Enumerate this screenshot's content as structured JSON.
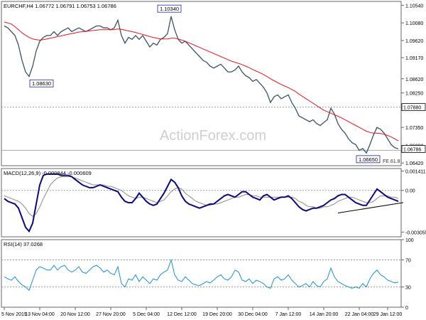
{
  "chart_data": [
    {
      "type": "line",
      "panel": "price",
      "title": "EURCHF,H4  1.06772 1.06791 1.06753 1.06786",
      "watermark": "ActionForex.com",
      "ylim": [
        1.0635,
        1.1064
      ],
      "y_ticks": [
        1.0642,
        1.0679,
        1.0716,
        1.0753,
        1.079,
        1.0827,
        1.0864,
        1.0901,
        1.0938,
        1.0975,
        1.1012,
        1.1049
      ],
      "y_tick_labels": [
        "1.06420",
        "1.06880",
        "1.07350",
        "1.07880",
        "1.08250",
        "1.08620",
        "1.09170",
        "1.09620",
        "1.10080",
        "1.10540"
      ],
      "y_tick_values": [
        1.0642,
        1.0688,
        1.0735,
        1.0788,
        1.0825,
        1.0862,
        1.0917,
        1.0962,
        1.1008,
        1.1054
      ],
      "current_price": {
        "value": 1.06786,
        "label": "1.06786"
      },
      "horizontal_line": {
        "value": 1.0788,
        "label": "1.07880"
      },
      "fe_line": {
        "value": 1.0679,
        "label": "FE 61.8"
      },
      "annotations": [
        {
          "label": "1.10340",
          "x": 46.5,
          "y": 1.1034
        },
        {
          "label": "1.08630",
          "x": 10.5,
          "y": 1.0863
        },
        {
          "label": "1.06650",
          "x": 102.5,
          "y": 1.0665
        }
      ],
      "series": [
        {
          "role": "price",
          "values": [
            1.1,
            1.0995,
            1.0985,
            1.0975,
            1.095,
            1.091,
            1.088,
            1.0868,
            1.0895,
            1.0935,
            1.096,
            1.097,
            1.0975,
            1.0975,
            1.0985,
            1.0975,
            1.0985,
            1.099,
            1.0995,
            1.0985,
            1.099,
            1.0995,
            1.099,
            1.0985,
            1.099,
            1.0995,
            1.1,
            1.1,
            1.0995,
            1.0995,
            1.099,
            1.0995,
            1.1015,
            1.0975,
            1.0955,
            1.097,
            1.0965,
            1.0975,
            1.0965,
            1.0975,
            1.096,
            1.0945,
            1.0955,
            1.095,
            1.0965,
            1.097,
            1.098,
            1.1025,
            1.099,
            1.0965,
            1.0955,
            1.096,
            1.095,
            1.094,
            1.093,
            1.092,
            1.091,
            1.0905,
            1.0895,
            1.089,
            1.0895,
            1.09,
            1.089,
            1.088,
            1.088,
            1.0885,
            1.0895,
            1.088,
            1.087,
            1.0865,
            1.0855,
            1.086,
            1.085,
            1.084,
            1.0825,
            1.08,
            1.0815,
            1.082,
            1.081,
            1.0815,
            1.082,
            1.08,
            1.0785,
            1.0765,
            1.076,
            1.0755,
            1.075,
            1.0755,
            1.0745,
            1.074,
            1.0748,
            1.0755,
            1.0785,
            1.077,
            1.0745,
            1.073,
            1.072,
            1.0705,
            1.0695,
            1.069,
            1.0675,
            1.068,
            1.0668,
            1.069,
            1.0715,
            1.0735,
            1.073,
            1.072,
            1.0705,
            1.069,
            1.0682,
            1.0679
          ]
        },
        {
          "role": "moving-average",
          "values": [
            1.101,
            1.1008,
            1.1005,
            1.0998,
            1.099,
            1.0982,
            1.0976,
            1.097,
            1.0966,
            1.0964,
            1.0963,
            1.0964,
            1.0966,
            1.0968,
            1.097,
            1.0972,
            1.0974,
            1.0976,
            1.0978,
            1.098,
            1.0982,
            1.0984,
            1.0985,
            1.0986,
            1.0987,
            1.0988,
            1.0989,
            1.099,
            1.099,
            1.099,
            1.099,
            1.099,
            1.0992,
            1.0991,
            1.0989,
            1.0987,
            1.0985,
            1.0983,
            1.098,
            1.0978,
            1.0975,
            1.0972,
            1.097,
            1.0968,
            1.0966,
            1.0966,
            1.0966,
            1.0968,
            1.0968,
            1.0966,
            1.0963,
            1.096,
            1.0956,
            1.0952,
            1.0948,
            1.0944,
            1.094,
            1.0936,
            1.0932,
            1.0928,
            1.0924,
            1.092,
            1.0916,
            1.0912,
            1.0908,
            1.0905,
            1.0902,
            1.0899,
            1.0895,
            1.0891,
            1.0886,
            1.0882,
            1.0878,
            1.0873,
            1.0868,
            1.0862,
            1.0857,
            1.0852,
            1.0847,
            1.0843,
            1.0839,
            1.0834,
            1.0829,
            1.0822,
            1.0816,
            1.081,
            1.0804,
            1.0798,
            1.0792,
            1.0786,
            1.078,
            1.0776,
            1.0772,
            1.0768,
            1.0764,
            1.076,
            1.0755,
            1.075,
            1.0745,
            1.074,
            1.0735,
            1.073,
            1.0725,
            1.0722,
            1.072,
            1.072,
            1.0719,
            1.0717,
            1.0714,
            1.071,
            1.0705,
            1.07
          ]
        }
      ]
    },
    {
      "type": "line",
      "panel": "macd",
      "title": "MACD(12,26,9) -0.000844 -0.000609",
      "ylim": [
        -0.0034,
        0.0016
      ],
      "y_tick_labels": [
        "0.001411",
        "0.00",
        "-0.003055"
      ],
      "y_tick_values": [
        0.001411,
        0.0,
        -0.003055
      ],
      "series": [
        {
          "role": "macd",
          "values": [
            -0.0006,
            -0.0008,
            -0.0009,
            -0.001,
            -0.0013,
            -0.002,
            -0.0027,
            -0.003,
            -0.0024,
            -0.001,
            0.0004,
            0.0011,
            0.0012,
            0.0012,
            0.0012,
            0.0012,
            0.0011,
            0.0011,
            0.0011,
            0.001,
            0.0008,
            0.0006,
            0.0004,
            0.0003,
            0.0002,
            0.0002,
            0.0003,
            0.0004,
            0.0003,
            0.0002,
            0.0001,
            0.0,
            -0.0001,
            -0.0005,
            -0.0008,
            -0.0009,
            -0.0009,
            -0.0006,
            -0.0002,
            -0.0005,
            -0.0008,
            -0.001,
            -0.0011,
            -0.001,
            -0.0006,
            -0.0002,
            0.0003,
            0.0008,
            0.0006,
            0.0002,
            -0.0004,
            -0.0008,
            -0.001,
            -0.0011,
            -0.0012,
            -0.0013,
            -0.0012,
            -0.0011,
            -0.001,
            -0.001,
            -0.0008,
            -0.0006,
            -0.0004,
            -0.0003,
            -0.0004,
            -0.0005,
            -0.0003,
            -0.0001,
            -0.0001,
            -0.0003,
            -0.0005,
            -0.0006,
            -0.0007,
            -0.0004,
            -0.0003,
            -0.0005,
            -0.0007,
            -0.0006,
            -0.0005,
            -0.0005,
            -0.0004,
            -0.0006,
            -0.0009,
            -0.0012,
            -0.0014,
            -0.0015,
            -0.0014,
            -0.0013,
            -0.0013,
            -0.0012,
            -0.0011,
            -0.0009,
            -0.0007,
            -0.0006,
            -0.0004,
            -0.0003,
            -0.0003,
            -0.0005,
            -0.0007,
            -0.0009,
            -0.001,
            -0.0011,
            -0.0011,
            -0.0007,
            -0.0003,
            0.0001,
            -0.0001,
            -0.0003,
            -0.0005,
            -0.0006,
            -0.0007,
            -0.0008
          ]
        },
        {
          "role": "signal",
          "values": [
            -0.0004,
            -0.0005,
            -0.0006,
            -0.0007,
            -0.0008,
            -0.001,
            -0.0013,
            -0.0017,
            -0.0019,
            -0.0017,
            -0.0012,
            -0.0006,
            -0.0001,
            0.0004,
            0.0007,
            0.0009,
            0.001,
            0.001,
            0.001,
            0.001,
            0.0009,
            0.0008,
            0.0007,
            0.0006,
            0.0005,
            0.0004,
            0.0004,
            0.0004,
            0.0004,
            0.0003,
            0.0003,
            0.0002,
            0.0001,
            0.0,
            -0.0002,
            -0.0004,
            -0.0005,
            -0.0006,
            -0.0005,
            -0.0005,
            -0.0006,
            -0.0007,
            -0.0008,
            -0.0009,
            -0.0008,
            -0.0007,
            -0.0004,
            -0.0001,
            0.0001,
            0.0002,
            0.0001,
            -0.0002,
            -0.0004,
            -0.0006,
            -0.0008,
            -0.0009,
            -0.001,
            -0.0011,
            -0.0011,
            -0.001,
            -0.001,
            -0.0009,
            -0.0008,
            -0.0007,
            -0.0006,
            -0.0005,
            -0.0005,
            -0.0004,
            -0.0003,
            -0.0003,
            -0.0004,
            -0.0004,
            -0.0005,
            -0.0005,
            -0.0005,
            -0.0005,
            -0.0005,
            -0.0005,
            -0.0005,
            -0.0005,
            -0.0005,
            -0.0005,
            -0.0006,
            -0.0008,
            -0.0009,
            -0.0011,
            -0.0012,
            -0.0012,
            -0.0013,
            -0.0013,
            -0.0012,
            -0.0012,
            -0.0011,
            -0.001,
            -0.0008,
            -0.0007,
            -0.0006,
            -0.0005,
            -0.0005,
            -0.0006,
            -0.0007,
            -0.0008,
            -0.0009,
            -0.0009,
            -0.0008,
            -0.0006,
            -0.0004,
            -0.0004,
            -0.0004,
            -0.0005,
            -0.0005,
            -0.0006
          ]
        }
      ],
      "trendline": {
        "x": [
          95,
          110
        ],
        "y": [
          -0.0015,
          -0.001
        ]
      }
    },
    {
      "type": "line",
      "panel": "rsi",
      "title": "RSI(14) 37.0268",
      "ylim": [
        0,
        100
      ],
      "y_tick_labels": [
        "100",
        "70",
        "30",
        "0"
      ],
      "y_tick_values": [
        100,
        70,
        30,
        0
      ],
      "levels": [
        70,
        30
      ],
      "series": [
        {
          "role": "rsi",
          "values": [
            45,
            42,
            40,
            45,
            38,
            33,
            30,
            25,
            40,
            55,
            60,
            58,
            55,
            55,
            62,
            55,
            60,
            62,
            55,
            52,
            55,
            60,
            52,
            50,
            55,
            60,
            62,
            58,
            52,
            55,
            50,
            48,
            60,
            35,
            30,
            42,
            40,
            48,
            38,
            45,
            40,
            35,
            42,
            40,
            48,
            52,
            55,
            70,
            48,
            40,
            38,
            45,
            40,
            35,
            33,
            32,
            35,
            38,
            36,
            40,
            45,
            48,
            42,
            40,
            45,
            55,
            52,
            40,
            38,
            42,
            35,
            40,
            38,
            35,
            30,
            28,
            42,
            45,
            40,
            42,
            48,
            40,
            35,
            30,
            32,
            35,
            30,
            38,
            32,
            30,
            38,
            42,
            58,
            45,
            38,
            35,
            32,
            30,
            28,
            30,
            28,
            35,
            30,
            42,
            50,
            55,
            48,
            45,
            40,
            38,
            36,
            37
          ]
        }
      ]
    }
  ],
  "x_axis": {
    "count": 112,
    "tick_labels": [
      "5 Nov 2019",
      "13 Nov 04:00",
      "20 Nov 12:00",
      "27 Nov 20:00",
      "5 Dec 04:00",
      "12 Dec 12:00",
      "19 Dec 20:00",
      "30 Dec 04:00",
      "7 Jan 12:00",
      "14 Jan 20:00",
      "22 Jan 04:00",
      "29 Jan 12:00"
    ],
    "tick_positions": [
      0,
      10,
      20,
      30,
      40,
      50,
      60,
      70,
      80,
      90,
      100,
      108
    ]
  },
  "colors": {
    "price": "#3a5363",
    "moving_average": "#e8141c",
    "macd": "#0a0a7a",
    "signal": "#8a8a8a",
    "rsi": "#1b8fd6",
    "grid": "#9a9a9a",
    "frame": "#666666",
    "watermark": "#cfcfcf",
    "text": "#000000"
  }
}
